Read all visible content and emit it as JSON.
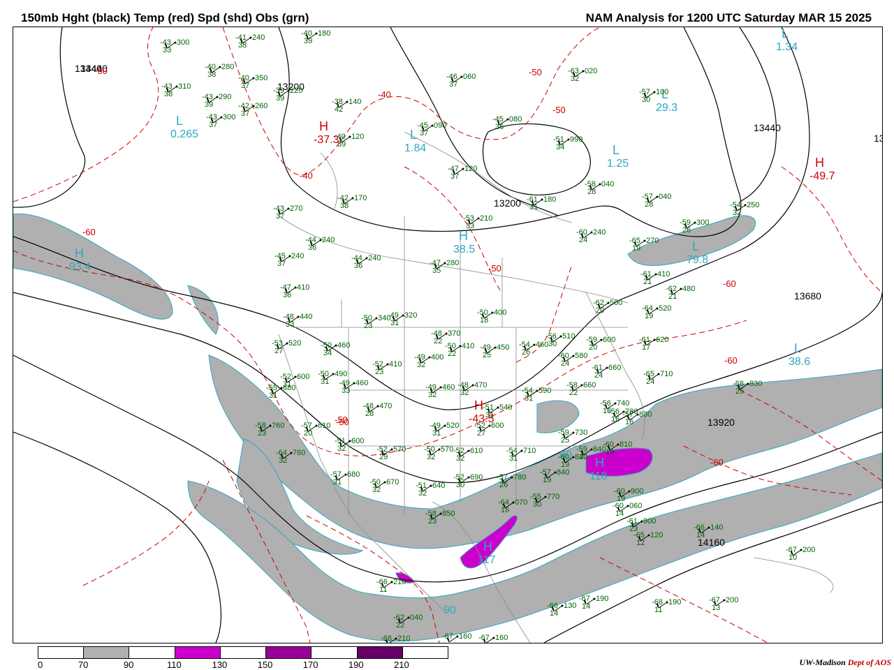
{
  "title": {
    "left": "150mb Hght (black) Temp (red) Spd (shd) Obs (grn)",
    "right": "NAM Analysis for 1200 UTC Saturday  MAR 15 2025"
  },
  "colors": {
    "height": "#000000",
    "temp": "#cc0000",
    "obs": "#006400",
    "speed_label": "#2ea6c4",
    "shade_70": "#b0b0b0",
    "shade_110": "#cc00cc",
    "shade_150": "#990099",
    "shade_190": "#660066"
  },
  "colorbar": {
    "ticks": [
      "0",
      "70",
      "90",
      "110",
      "130",
      "150",
      "170",
      "190",
      "210"
    ],
    "segments": [
      "#ffffff",
      "#b0b0b0",
      "#ffffff",
      "#cc00cc",
      "#ffffff",
      "#990099",
      "#ffffff",
      "#660066",
      "#ffffff"
    ]
  },
  "credit": {
    "org": "UW-Madison",
    "dept": "Dept of AOS"
  },
  "height_labels": [
    "13440",
    "13200",
    "13200",
    "13440",
    "13680",
    "13920",
    "14160",
    "13",
    "13440"
  ],
  "temp_labels": [
    "-50",
    "-40",
    "-40",
    "-50",
    "-50",
    "-60",
    "-60",
    "-50",
    "-50",
    "-60",
    "-50",
    "-60"
  ],
  "highs_lows": [
    {
      "letter": "L",
      "value": "0.265"
    },
    {
      "letter": "H",
      "value": "-37.3"
    },
    {
      "letter": "L",
      "value": "1.84"
    },
    {
      "letter": "L",
      "value": "1.25"
    },
    {
      "letter": "H",
      "value": "-49.7"
    },
    {
      "letter": "L",
      "value": "29.3"
    },
    {
      "letter": "H",
      "value": "93.4"
    },
    {
      "letter": "H",
      "value": "38.5"
    },
    {
      "letter": "L",
      "value": "79.8"
    },
    {
      "letter": "L",
      "value": "38.6"
    },
    {
      "letter": "H",
      "value": "118"
    },
    {
      "letter": "H",
      "value": "117"
    },
    {
      "letter": "H",
      "value": "-43.5"
    },
    {
      "letter": "L",
      "value": "1.34"
    },
    {
      "letter": "",
      "value": "90"
    },
    {
      "letter": "",
      "value": "90"
    }
  ],
  "obs": [
    {
      "t": "-43",
      "h": "300",
      "d": "33"
    },
    {
      "t": "-41",
      "h": "240",
      "d": "38"
    },
    {
      "t": "-40",
      "h": "180",
      "d": "39"
    },
    {
      "t": "-40",
      "h": "280",
      "d": "38"
    },
    {
      "t": "-40",
      "h": "350",
      "d": "37"
    },
    {
      "t": "-39",
      "h": "220",
      "d": "39"
    },
    {
      "t": "-43",
      "h": "310",
      "d": "38"
    },
    {
      "t": "-43",
      "h": "290",
      "d": "39"
    },
    {
      "t": "-42",
      "h": "260",
      "d": "37"
    },
    {
      "t": "-43",
      "h": "300",
      "d": "37"
    },
    {
      "t": "-38",
      "h": "140",
      "d": "42"
    },
    {
      "t": "-40",
      "h": "120",
      "d": "39"
    },
    {
      "t": "-46",
      "h": "060",
      "d": "37"
    },
    {
      "t": "-45",
      "h": "090",
      "d": "37"
    },
    {
      "t": "-45",
      "h": "080",
      "d": "36"
    },
    {
      "t": "-63",
      "h": "020",
      "d": "32"
    },
    {
      "t": "-57",
      "h": "100",
      "d": "30"
    },
    {
      "t": "-51",
      "h": "990",
      "d": "34"
    },
    {
      "t": "-47",
      "h": "120",
      "d": "37"
    },
    {
      "t": "-58",
      "h": "040",
      "d": "28"
    },
    {
      "t": "-57",
      "h": "040",
      "d": "28"
    },
    {
      "t": "-42",
      "h": "170",
      "d": "38"
    },
    {
      "t": "-43",
      "h": "270",
      "d": "37"
    },
    {
      "t": "-61",
      "h": "180",
      "d": "31"
    },
    {
      "t": "-53",
      "h": "210",
      "d": "33"
    },
    {
      "t": "-54",
      "h": "250",
      "d": "32"
    },
    {
      "t": "-59",
      "h": "300",
      "d": "26"
    },
    {
      "t": "-60",
      "h": "240",
      "d": "24"
    },
    {
      "t": "-65",
      "h": "270",
      "d": "19"
    },
    {
      "t": "-44",
      "h": "240",
      "d": "36"
    },
    {
      "t": "-44",
      "h": "240",
      "d": "36"
    },
    {
      "t": "-45",
      "h": "240",
      "d": "37"
    },
    {
      "t": "-47",
      "h": "280",
      "d": "35"
    },
    {
      "t": "-61",
      "h": "410",
      "d": "21"
    },
    {
      "t": "-62",
      "h": "480",
      "d": "21"
    },
    {
      "t": "-47",
      "h": "410",
      "d": "36"
    },
    {
      "t": "-62",
      "h": "500",
      "d": "20"
    },
    {
      "t": "-64",
      "h": "520",
      "d": "19"
    },
    {
      "t": "-48",
      "h": "440",
      "d": "33"
    },
    {
      "t": "-50",
      "h": "340",
      "d": "23"
    },
    {
      "t": "-49",
      "h": "320",
      "d": "31"
    },
    {
      "t": "-50",
      "h": "400",
      "d": "18"
    },
    {
      "t": "-53",
      "h": "520",
      "d": "27"
    },
    {
      "t": "-50",
      "h": "460",
      "d": "34"
    },
    {
      "t": "-48",
      "h": "370",
      "d": "22"
    },
    {
      "t": "-50",
      "h": "410",
      "d": "22"
    },
    {
      "t": "-49",
      "h": "450",
      "d": "25"
    },
    {
      "t": "-54",
      "h": "460",
      "d": "26"
    },
    {
      "t": "-56",
      "h": "510",
      "d": "30"
    },
    {
      "t": "-59",
      "h": "600",
      "d": "20"
    },
    {
      "t": "-61",
      "h": "620",
      "d": "17"
    },
    {
      "t": "-52",
      "h": "600",
      "d": "31"
    },
    {
      "t": "-52",
      "h": "410",
      "d": "23"
    },
    {
      "t": "-49",
      "h": "400",
      "d": "32"
    },
    {
      "t": "-60",
      "h": "580",
      "d": "24"
    },
    {
      "t": "-61",
      "h": "660",
      "d": "24"
    },
    {
      "t": "-55",
      "h": "680",
      "d": "31"
    },
    {
      "t": "-50",
      "h": "490",
      "d": "31"
    },
    {
      "t": "-49",
      "h": "460",
      "d": "33"
    },
    {
      "t": "-49",
      "h": "460",
      "d": "32"
    },
    {
      "t": "-48",
      "h": "470",
      "d": "32"
    },
    {
      "t": "-51",
      "h": "540",
      "d": "31"
    },
    {
      "t": "-54",
      "h": "590",
      "d": "31"
    },
    {
      "t": "-58",
      "h": "660",
      "d": "22"
    },
    {
      "t": "-65",
      "h": "710",
      "d": "24"
    },
    {
      "t": "-68",
      "h": "830",
      "d": "25"
    },
    {
      "t": "-48",
      "h": "470",
      "d": "28"
    },
    {
      "t": "-56",
      "h": "740",
      "d": "16"
    },
    {
      "t": "-56",
      "h": "780",
      "d": "16"
    },
    {
      "t": "-57",
      "h": "830",
      "d": "16"
    },
    {
      "t": "-57",
      "h": "610",
      "d": "20"
    },
    {
      "t": "-49",
      "h": "520",
      "d": "31"
    },
    {
      "t": "-52",
      "h": "600",
      "d": "27"
    },
    {
      "t": "-58",
      "h": "760",
      "d": "23"
    },
    {
      "t": "-51",
      "h": "600",
      "d": "32"
    },
    {
      "t": "-52",
      "h": "570",
      "d": "29"
    },
    {
      "t": "-50",
      "h": "570",
      "d": "32"
    },
    {
      "t": "-52",
      "h": "610",
      "d": "32"
    },
    {
      "t": "-54",
      "h": "710",
      "d": "31"
    },
    {
      "t": "-59",
      "h": "730",
      "d": "25"
    },
    {
      "t": "-60",
      "h": "810",
      "d": "19"
    },
    {
      "t": "-64",
      "h": "760",
      "d": "32"
    },
    {
      "t": "-57",
      "h": "680",
      "d": "31"
    },
    {
      "t": "-50",
      "h": "670",
      "d": "32"
    },
    {
      "t": "-51",
      "h": "640",
      "d": "32"
    },
    {
      "t": "-52",
      "h": "690",
      "d": "30"
    },
    {
      "t": "-57",
      "h": "780",
      "d": "26"
    },
    {
      "t": "-57",
      "h": "840",
      "d": "19"
    },
    {
      "t": "-60",
      "h": "840",
      "d": "19"
    },
    {
      "t": "-59",
      "h": "840",
      "d": "20"
    },
    {
      "t": "-60",
      "h": "900",
      "d": "19"
    },
    {
      "t": "-60",
      "h": "060",
      "d": "14"
    },
    {
      "t": "-64",
      "h": "070",
      "d": "16"
    },
    {
      "t": "-58",
      "h": "850",
      "d": "23"
    },
    {
      "t": "-55",
      "h": "770",
      "d": "30"
    },
    {
      "t": "-61",
      "h": "900",
      "d": "23"
    },
    {
      "t": "-65",
      "h": "120",
      "d": "12"
    },
    {
      "t": "-66",
      "h": "140",
      "d": "14"
    },
    {
      "t": "-67",
      "h": "200",
      "d": "10"
    },
    {
      "t": "-66",
      "h": "210",
      "d": "11"
    },
    {
      "t": "-62",
      "h": "040",
      "d": "22"
    },
    {
      "t": "-66",
      "h": "130",
      "d": "14"
    },
    {
      "t": "-67",
      "h": "190",
      "d": "14"
    },
    {
      "t": "-68",
      "h": "190",
      "d": "11"
    },
    {
      "t": "-67",
      "h": "200",
      "d": "13"
    },
    {
      "t": "-68",
      "h": "210",
      "d": "11"
    },
    {
      "t": "-67",
      "h": "160",
      "d": ""
    },
    {
      "t": "-67",
      "h": "160",
      "d": ""
    },
    {
      "t": "-67",
      "h": "230",
      "d": ""
    }
  ]
}
